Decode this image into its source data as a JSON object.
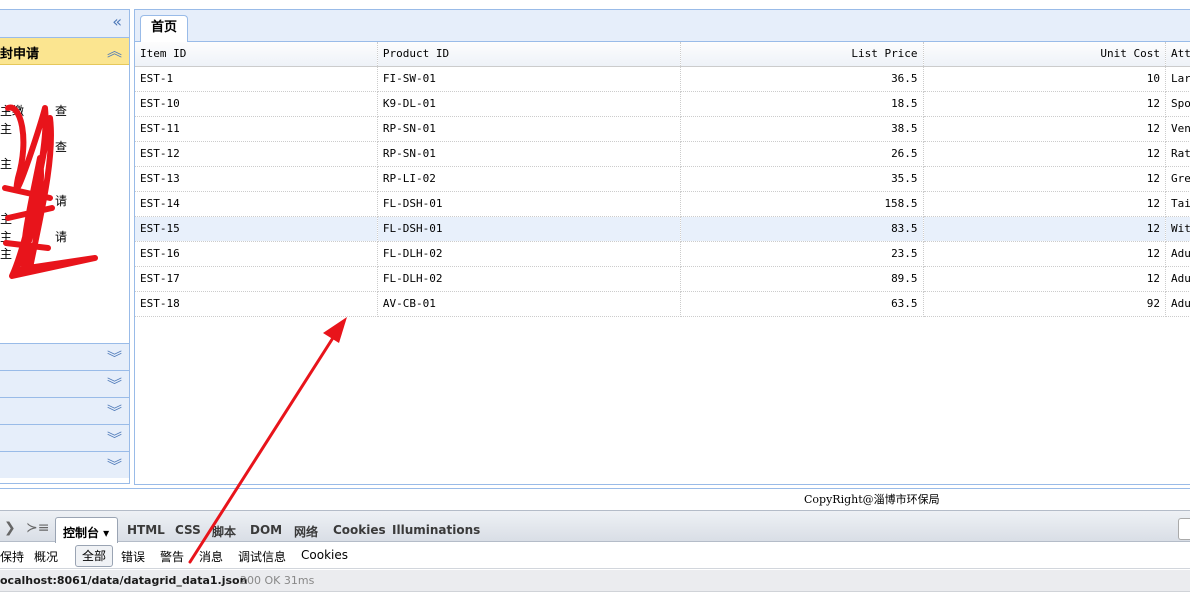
{
  "sidebar": {
    "collapse_icon": "«",
    "active_panel_title": "封申请",
    "chevron_up": "︽",
    "chevron_down": "︾",
    "menu_items": [
      "主缴",
      "查",
      "主",
      "查",
      "主",
      "请",
      "主",
      "主",
      "请",
      "主"
    ],
    "collapsed_panel_count": 5
  },
  "tabs": {
    "home_label": "首页"
  },
  "grid": {
    "columns": [
      "Item ID",
      "Product ID",
      "List Price",
      "Unit Cost",
      "Att"
    ],
    "rows": [
      {
        "item_id": "EST-1",
        "product_id": "FI-SW-01",
        "list_price": "36.5",
        "unit_cost": "10",
        "attr": "Lar"
      },
      {
        "item_id": "EST-10",
        "product_id": "K9-DL-01",
        "list_price": "18.5",
        "unit_cost": "12",
        "attr": "Spo"
      },
      {
        "item_id": "EST-11",
        "product_id": "RP-SN-01",
        "list_price": "38.5",
        "unit_cost": "12",
        "attr": "Ven"
      },
      {
        "item_id": "EST-12",
        "product_id": "RP-SN-01",
        "list_price": "26.5",
        "unit_cost": "12",
        "attr": "Rat"
      },
      {
        "item_id": "EST-13",
        "product_id": "RP-LI-02",
        "list_price": "35.5",
        "unit_cost": "12",
        "attr": "Gre"
      },
      {
        "item_id": "EST-14",
        "product_id": "FL-DSH-01",
        "list_price": "158.5",
        "unit_cost": "12",
        "attr": "Tai"
      },
      {
        "item_id": "EST-15",
        "product_id": "FL-DSH-01",
        "list_price": "83.5",
        "unit_cost": "12",
        "attr": "Wit"
      },
      {
        "item_id": "EST-16",
        "product_id": "FL-DLH-02",
        "list_price": "23.5",
        "unit_cost": "12",
        "attr": "Adu"
      },
      {
        "item_id": "EST-17",
        "product_id": "FL-DLH-02",
        "list_price": "89.5",
        "unit_cost": "12",
        "attr": "Adu"
      },
      {
        "item_id": "EST-18",
        "product_id": "AV-CB-01",
        "list_price": "63.5",
        "unit_cost": "92",
        "attr": "Adu"
      }
    ],
    "selected_row_index": 6
  },
  "footer": {
    "copyright": "CopyRight@淄博市环保局"
  },
  "devtools": {
    "tabs": [
      "控制台 ▾",
      "HTML",
      "CSS",
      "脚本",
      "DOM",
      "网络",
      "Cookies",
      "Illuminations"
    ],
    "filters": [
      "保持",
      "概况",
      "全部",
      "错误",
      "警告",
      "消息",
      "调试信息",
      "Cookies"
    ],
    "log_url": "ocalhost:8061/data/datagrid_data1.json",
    "log_status": "200 OK 31ms"
  },
  "colors": {
    "accent": "#99bbe8",
    "active_panel": "#fbe590",
    "annotation": "#e8141b"
  }
}
